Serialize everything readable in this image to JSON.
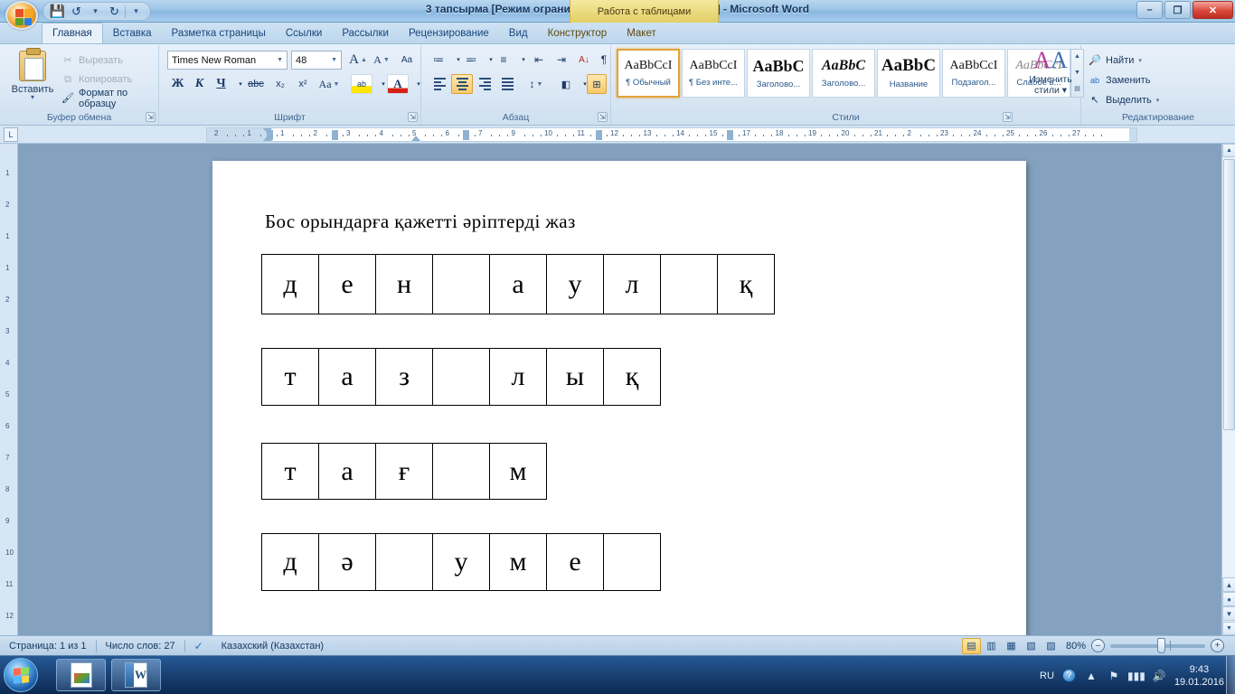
{
  "window": {
    "title": "3 тапсырма [Режим ограниченной функциональности] - Microsoft Word",
    "contextual_tab_title": "Работа с таблицами",
    "minimize": "–",
    "restore": "❐",
    "close": "✕"
  },
  "quick_access": {
    "save": "💾",
    "undo": "↺",
    "undo_caret": "▾",
    "redo": "↻",
    "more_caret": "▾"
  },
  "tabs": [
    {
      "label": "Главная",
      "active": true
    },
    {
      "label": "Вставка",
      "active": false
    },
    {
      "label": "Разметка страницы",
      "active": false
    },
    {
      "label": "Ссылки",
      "active": false
    },
    {
      "label": "Рассылки",
      "active": false
    },
    {
      "label": "Рецензирование",
      "active": false
    },
    {
      "label": "Вид",
      "active": false
    },
    {
      "label": "Конструктор",
      "active": false
    },
    {
      "label": "Макет",
      "active": false
    }
  ],
  "ribbon": {
    "clipboard": {
      "group_label": "Буфер обмена",
      "paste": "Вставить",
      "paste_caret": "▾",
      "cut": "Вырезать",
      "cut_icon": "✂",
      "copy": "Копировать",
      "copy_icon": "⧉",
      "format_painter": "Формат по образцу",
      "format_painter_icon": "🖌",
      "dialog_launcher": "⇲"
    },
    "font": {
      "group_label": "Шрифт",
      "font_name": "Times New Roman",
      "font_size": "48",
      "grow_font": "A",
      "shrink_font": "A",
      "clear_formatting": "Aa",
      "bold": "Ж",
      "italic": "К",
      "underline": "Ч",
      "underline_caret": "▾",
      "strikethrough": "abc",
      "subscript": "x₂",
      "superscript": "x²",
      "change_case": "Aa",
      "change_case_caret": "▾",
      "highlight": "ab",
      "highlight_caret": "▾",
      "font_color": "A",
      "font_color_caret": "▾",
      "dialog_launcher": "⇲"
    },
    "paragraph": {
      "group_label": "Абзац",
      "bullets": "≔",
      "bullets_caret": "▾",
      "numbering": "≕",
      "numbering_caret": "▾",
      "multilevel": "≡",
      "multilevel_caret": "▾",
      "decrease_indent": "⇤",
      "increase_indent": "⇥",
      "sort": "A↓",
      "show_marks": "¶",
      "align_left": "",
      "align_center": "",
      "align_right": "",
      "justify": "",
      "line_spacing": "↕",
      "line_spacing_caret": "▾",
      "shading": "◧",
      "shading_caret": "▾",
      "borders": "⊞",
      "borders_caret": "▾",
      "dialog_launcher": "⇲"
    },
    "styles": {
      "group_label": "Стили",
      "items": [
        {
          "preview": "AaBbCcI",
          "name": "¶ Обычный",
          "selected": true
        },
        {
          "preview": "AaBbCcI",
          "name": "¶ Без инте...",
          "selected": false
        },
        {
          "preview": "AaBbC",
          "name": "Заголово...",
          "selected": false
        },
        {
          "preview": "AaBbC",
          "name": "Заголово...",
          "selected": false
        },
        {
          "preview": "AaBbC",
          "name": "Название",
          "selected": false
        },
        {
          "preview": "AaBbCcI",
          "name": "Подзагол...",
          "selected": false
        },
        {
          "preview": "AaBbCcI",
          "name": "Слабое в...",
          "selected": false
        }
      ],
      "scroll_up": "▲",
      "scroll_down": "▼",
      "scroll_more": "▤",
      "change_styles_line1": "Изменить",
      "change_styles_line2": "стили ▾",
      "change_styles_glyph_a": "A",
      "change_styles_glyph_b": "A",
      "dialog_launcher": "⇲"
    },
    "editing": {
      "group_label": "Редактирование",
      "find": "Найти",
      "find_icon": "🔎",
      "find_caret": "▾",
      "replace": "Заменить",
      "replace_icon": "ab",
      "select": "Выделить",
      "select_icon": "↖",
      "select_caret": "▾"
    }
  },
  "ruler": {
    "corner_label": "L",
    "numbers": [
      "2",
      "1",
      "1",
      "2",
      "3",
      "4",
      "5",
      "6",
      "7",
      "9",
      "10",
      "11",
      "12",
      "13",
      "14",
      "15",
      "17",
      "18",
      "19",
      "20",
      "21",
      "2",
      "23",
      "24",
      "25",
      "26",
      "27"
    ]
  },
  "document": {
    "heading": "Бос  орындарға  қажетті  әріптерді  жаз",
    "tables": [
      {
        "cells": [
          "д",
          "е",
          "н",
          "",
          "а",
          "у",
          "л",
          "",
          "қ"
        ]
      },
      {
        "cells": [
          "т",
          "а",
          "з",
          "",
          "л",
          "ы",
          "қ"
        ]
      },
      {
        "cells": [
          "т",
          "а",
          "ғ",
          "",
          "м"
        ]
      },
      {
        "cells": [
          "д",
          "ә",
          "",
          "у",
          "м",
          "е",
          ""
        ]
      }
    ]
  },
  "status_bar": {
    "page": "Страница: 1 из 1",
    "words": "Число слов: 27",
    "proofing_icon": "✓",
    "language": "Казахский (Казахстан)",
    "views": [
      {
        "icon": "▤",
        "name": "print-layout",
        "active": true
      },
      {
        "icon": "▥",
        "name": "full-screen-reading",
        "active": false
      },
      {
        "icon": "▦",
        "name": "web-layout",
        "active": false
      },
      {
        "icon": "▧",
        "name": "outline",
        "active": false
      },
      {
        "icon": "▨",
        "name": "draft",
        "active": false
      }
    ],
    "zoom_level": "80%",
    "zoom_out": "–",
    "zoom_in": "+"
  },
  "taskbar": {
    "start": "start-orb",
    "buttons": [
      {
        "name": "image-file-window",
        "icon": "picture"
      },
      {
        "name": "word-window",
        "icon": "W"
      }
    ],
    "tray": {
      "language": "RU",
      "help": "?",
      "network_icon": "▮▮▮",
      "volume_icon": "🔊",
      "action_center_icon": "⚑",
      "show_hidden_icon": "▲",
      "time": "9:43",
      "date": "19.01.2016"
    }
  },
  "colors": {
    "accent": "#f8c96a",
    "ribbon_bg": "#dfeaf6",
    "page_bg": "#ffffff",
    "desktop": "#84a2c0"
  }
}
